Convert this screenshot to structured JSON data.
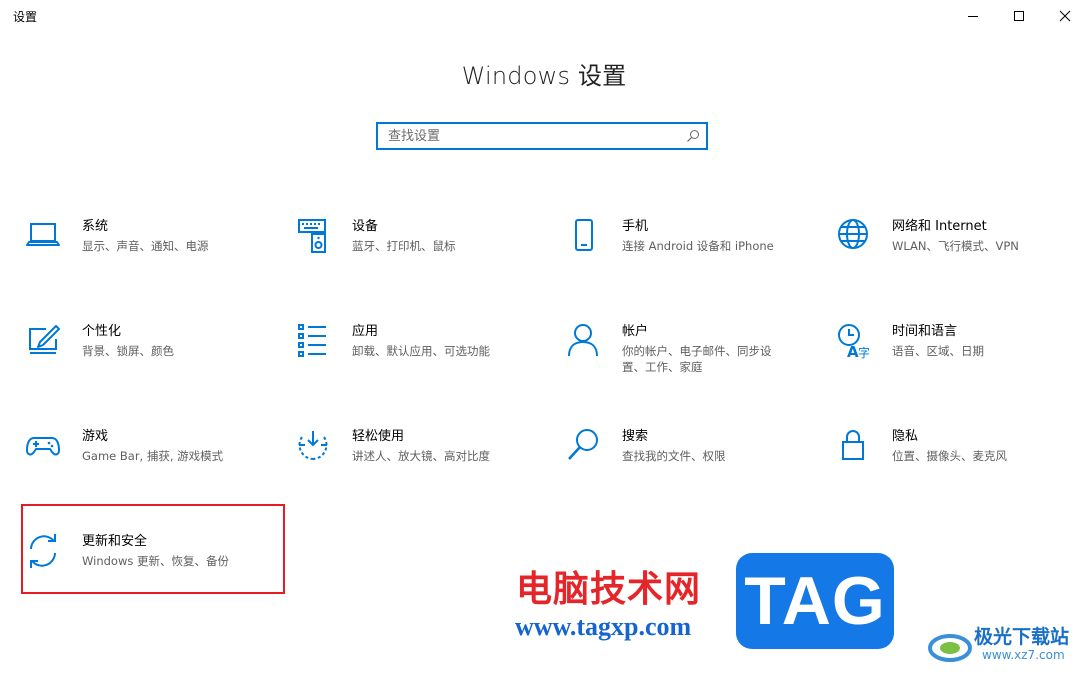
{
  "window": {
    "title": "设置"
  },
  "header": {
    "title": "Windows 设置"
  },
  "search": {
    "placeholder": "查找设置",
    "value": ""
  },
  "tiles": [
    {
      "name": "系统",
      "desc": "显示、声音、通知、电源",
      "icon": "laptop-icon"
    },
    {
      "name": "设备",
      "desc": "蓝牙、打印机、鼠标",
      "icon": "keyboard-speaker-icon"
    },
    {
      "name": "手机",
      "desc": "连接 Android 设备和 iPhone",
      "icon": "phone-icon"
    },
    {
      "name": "网络和 Internet",
      "desc": "WLAN、飞行模式、VPN",
      "icon": "globe-icon"
    },
    {
      "name": "个性化",
      "desc": "背景、锁屏、颜色",
      "icon": "paint-brush-icon"
    },
    {
      "name": "应用",
      "desc": "卸载、默认应用、可选功能",
      "icon": "apps-list-icon"
    },
    {
      "name": "帐户",
      "desc": "你的帐户、电子邮件、同步设置、工作、家庭",
      "icon": "person-icon"
    },
    {
      "name": "时间和语言",
      "desc": "语音、区域、日期",
      "icon": "time-language-icon"
    },
    {
      "name": "游戏",
      "desc": "Game Bar, 捕获, 游戏模式",
      "icon": "gamepad-icon"
    },
    {
      "name": "轻松使用",
      "desc": "讲述人、放大镜、高对比度",
      "icon": "ease-of-access-icon"
    },
    {
      "name": "搜索",
      "desc": "查找我的文件、权限",
      "icon": "search-icon"
    },
    {
      "name": "隐私",
      "desc": "位置、摄像头、麦克风",
      "icon": "lock-icon"
    },
    {
      "name": "更新和安全",
      "desc": "Windows 更新、恢复、备份",
      "icon": "sync-icon"
    }
  ],
  "watermark": {
    "site_cn": "电脑技术网",
    "site_url": "www.tagxp.com",
    "tag": "TAG",
    "logo_cn": "极光下载站",
    "logo_url": "www.xz7.com"
  },
  "colors": {
    "accent": "#0078d7",
    "highlight": "#e51c23"
  }
}
